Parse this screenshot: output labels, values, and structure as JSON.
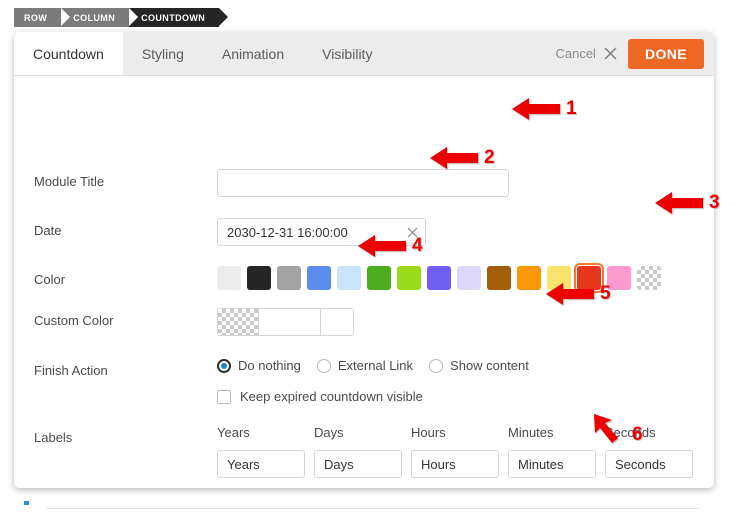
{
  "breadcrumb": {
    "items": [
      {
        "label": "ROW",
        "active": false
      },
      {
        "label": "COLUMN",
        "active": false
      },
      {
        "label": "COUNTDOWN",
        "active": true
      }
    ]
  },
  "modal": {
    "tabs": [
      {
        "label": "Countdown",
        "active": true
      },
      {
        "label": "Styling",
        "active": false
      },
      {
        "label": "Animation",
        "active": false
      },
      {
        "label": "Visibility",
        "active": false
      }
    ],
    "cancel_label": "Cancel",
    "cancel_icon": "close-x-icon",
    "done_label": "DONE",
    "done_color": "#ef6724"
  },
  "form": {
    "module_title": {
      "label": "Module Title",
      "value": "",
      "placeholder": ""
    },
    "date": {
      "label": "Date",
      "value": "2030-12-31 16:00:00",
      "clear_icon": "clear-x-icon"
    },
    "color": {
      "label": "Color",
      "selected_index": 12,
      "swatches": [
        {
          "name": "white-smoke",
          "hex": "#ececec"
        },
        {
          "name": "near-black",
          "hex": "#262626"
        },
        {
          "name": "gray",
          "hex": "#a3a3a3"
        },
        {
          "name": "cornflower-blue",
          "hex": "#5b8def"
        },
        {
          "name": "light-blue",
          "hex": "#c9e3fb"
        },
        {
          "name": "green",
          "hex": "#4cae1f"
        },
        {
          "name": "yellow-green",
          "hex": "#9ada1b"
        },
        {
          "name": "medium-purple",
          "hex": "#6f5ef0"
        },
        {
          "name": "lavender",
          "hex": "#ddd8fb"
        },
        {
          "name": "brown",
          "hex": "#a35e0a"
        },
        {
          "name": "orange",
          "hex": "#f99806"
        },
        {
          "name": "light-yellow",
          "hex": "#fae46e"
        },
        {
          "name": "red",
          "hex": "#e8361c"
        },
        {
          "name": "pink",
          "hex": "#fd9bd1"
        },
        {
          "name": "transparent",
          "hex": "transparent"
        }
      ]
    },
    "custom_color": {
      "label": "Custom Color",
      "value": "",
      "placeholder": "",
      "swatch": "transparent"
    },
    "finish_action": {
      "label": "Finish Action",
      "selected": "Do nothing",
      "options": [
        "Do nothing",
        "External Link",
        "Show content"
      ],
      "keep_visible_label": "Keep expired countdown visible",
      "keep_visible_checked": false
    },
    "labels": {
      "label": "Labels",
      "headers": [
        "Years",
        "Days",
        "Hours",
        "Minutes",
        "Seconds"
      ],
      "values": [
        "Years",
        "Days",
        "Hours",
        "Minutes",
        "Seconds"
      ]
    }
  },
  "annotations": [
    {
      "number": "1",
      "style": "left-arrow"
    },
    {
      "number": "2",
      "style": "left-arrow"
    },
    {
      "number": "3",
      "style": "left-arrow"
    },
    {
      "number": "4",
      "style": "left-arrow"
    },
    {
      "number": "5",
      "style": "left-arrow"
    },
    {
      "number": "6",
      "style": "diagonal-arrow"
    }
  ]
}
